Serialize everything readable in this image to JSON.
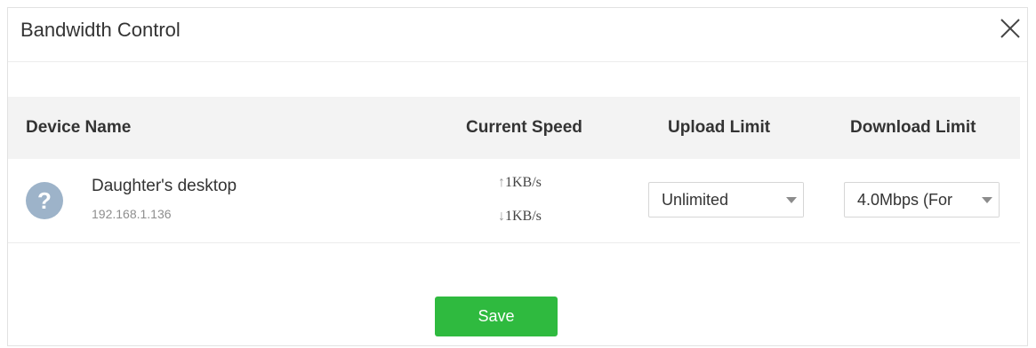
{
  "dialog": {
    "title": "Bandwidth Control",
    "close_icon": "close-icon"
  },
  "table": {
    "headers": {
      "device_name": "Device Name",
      "current_speed": "Current Speed",
      "upload_limit": "Upload Limit",
      "download_limit": "Download Limit"
    },
    "rows": [
      {
        "avatar_icon": "question-mark-icon",
        "avatar_text": "?",
        "device_name": "Daughter's desktop",
        "ip": "192.168.1.136",
        "upload_speed": "1KB/s",
        "download_speed": "1KB/s",
        "upload_limit": "Unlimited",
        "download_limit": "4.0Mbps (For"
      }
    ]
  },
  "actions": {
    "save_label": "Save"
  },
  "colors": {
    "save_button": "#2fba3f",
    "header_background": "#f3f3f3",
    "avatar": "#9db3c9"
  }
}
